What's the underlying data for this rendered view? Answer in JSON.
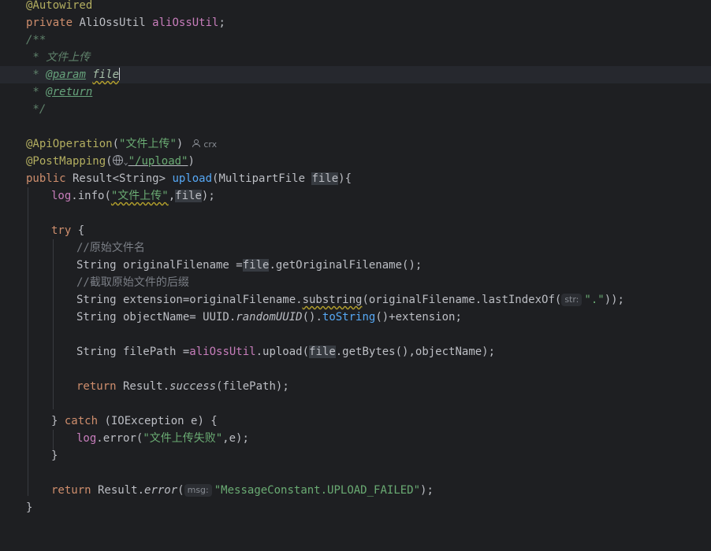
{
  "code": {
    "l1": {
      "ann": "@Autowired"
    },
    "l2": {
      "kw": "private",
      "type": " AliOssUtil ",
      "field": "aliOssUtil",
      "end": ";"
    },
    "l3": {
      "open": "/**"
    },
    "l4": {
      "star": " * ",
      "text": "文件上传"
    },
    "l5": {
      "star": " * ",
      "tag": "@param",
      "sp": " ",
      "param": "file"
    },
    "l6": {
      "star": " * ",
      "tag": "@return"
    },
    "l7": {
      "close": " */"
    },
    "l8": {
      "ann": "@ApiOperation",
      "p1": "(",
      "str": "\"文件上传\"",
      "p2": ")",
      "author": "crx"
    },
    "l9": {
      "ann": "@PostMapping",
      "p1": "(",
      "chev": "⌄",
      "str": "\"/upload\"",
      "p2": ")"
    },
    "l10": {
      "kw": "public",
      "t1": " Result<String> ",
      "fn": "upload",
      "t2": "(MultipartFile ",
      "param": "file",
      "t3": "){"
    },
    "l11": {
      "log": "log",
      "t1": ".info(",
      "str": "\"文件上传\"",
      "t2": ",",
      "param": "file",
      "t3": ");"
    },
    "l12": {
      "kw": "try",
      "t1": " {"
    },
    "l13": {
      "cmt": "//原始文件名"
    },
    "l14": {
      "t1": "String originalFilename =",
      "param": "file",
      "t2": ".getOriginalFilename();"
    },
    "l15": {
      "cmt": "//截取原始文件的后缀"
    },
    "l16": {
      "t1": "String extension=originalFilename.",
      "sub": "substring",
      "t2": "(originalFilename.lastIndexOf(",
      "hint": "str:",
      "str": "\".\"",
      "t3": "));"
    },
    "l17": {
      "t1": "String objectName= UUID.",
      "it": "randomUUID",
      "t2": "().",
      "ts": "toString",
      "t3": "()+extension;"
    },
    "l18": {
      "t1": "String filePath =",
      "field": "aliOssUtil",
      "t2": ".upload(",
      "param": "file",
      "t3": ".getBytes(),objectName);"
    },
    "l19": {
      "kw": "return",
      "t1": " Result.",
      "it": "success",
      "t2": "(filePath);"
    },
    "l20": {
      "t1": "} ",
      "kw": "catch",
      "t2": " (IOException e) {"
    },
    "l21": {
      "log": "log",
      "t1": ".error(",
      "str": "\"文件上传失败\"",
      "t2": ",e);"
    },
    "l22": {
      "t1": "}"
    },
    "l23": {
      "kw": "return",
      "t1": " Result.",
      "it": "error",
      "t2": "(",
      "hint": "msg:",
      "str": "\"MessageConstant.UPLOAD_FAILED\"",
      "t3": ");"
    },
    "l24": {
      "t1": "}"
    }
  }
}
